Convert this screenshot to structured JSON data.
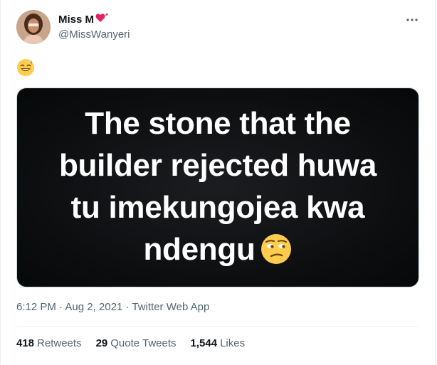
{
  "author": {
    "display_name": "Miss M",
    "handle": "@MissWanyeri"
  },
  "tweet": {
    "emoji_icon": "grinning-sweat-emoji",
    "image_text": {
      "lines": [
        "The stone that the",
        "builder rejected huwa",
        "tu imekungojea kwa",
        "ndengu"
      ],
      "trailing_emoji": "unamused-face-emoji"
    }
  },
  "meta": {
    "time": "6:12 PM",
    "separator": "·",
    "date": "Aug 2, 2021",
    "source": "Twitter Web App"
  },
  "stats": {
    "retweets_count": "418",
    "retweets_label": "Retweets",
    "quotes_count": "29",
    "quotes_label": "Quote Tweets",
    "likes_count": "1,544",
    "likes_label": "Likes"
  },
  "colors": {
    "text_primary": "#0f1419",
    "text_secondary": "#536471",
    "heart": "#e0245e",
    "media_background": "#0c0d0f"
  }
}
